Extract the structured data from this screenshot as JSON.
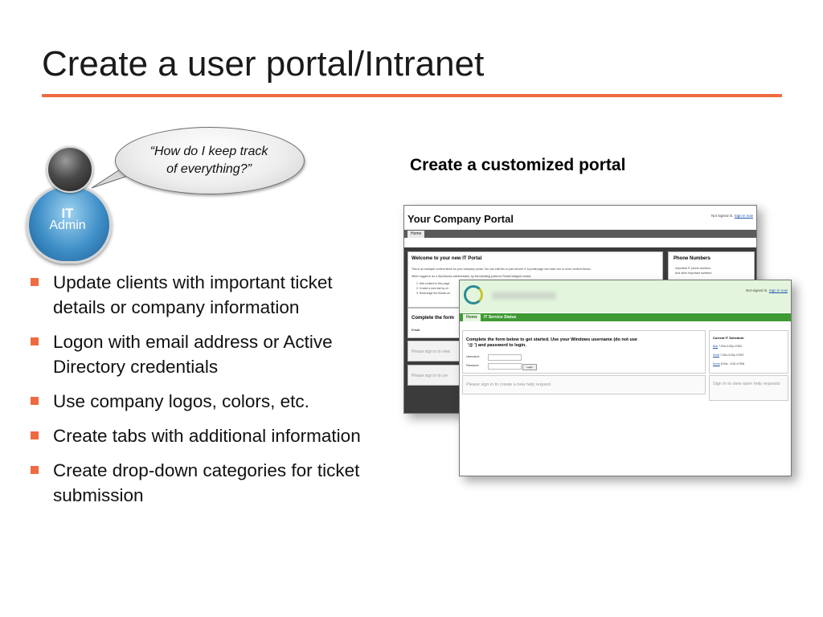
{
  "slide": {
    "title": "Create a user portal/Intranet",
    "accent_color": "#ef6b3f"
  },
  "admin_figure": {
    "icon": "person-admin-icon",
    "line1": "IT",
    "line2": "Admin"
  },
  "bubble": {
    "line1": "“How do I keep track",
    "line2": "of everything?”"
  },
  "portal_heading": "Create a customized portal",
  "bullets": [
    "Update clients with important ticket details or company information",
    "Logon with email address or Active Directory credentials",
    "Use company logos, colors, etc.",
    "Create tabs with additional information",
    "Create drop-down categories for ticket submission"
  ],
  "back_portal": {
    "title": "Your Company Portal",
    "signin_prefix": "Not signed in.",
    "signin_link": "Sign in now",
    "tab_home": "Home",
    "welcome_heading": "Welcome to your new IT Portal",
    "welcome_lines": [
      "This is an example content block for your company portal. You can edit this or just remove it. A portal page can have one or more content blocks.",
      "When logged in as a Spiceworks administrator, try the following (when in Portal Designer mode):",
      "1. Add content to this page",
      "2. Create a new tab by cli",
      "3. Rearrange the blocks on"
    ],
    "phone_heading": "Phone Numbers",
    "phone_lines": [
      "Important IT phone numbers",
      "And other important numbers"
    ],
    "form_heading": "Complete the form",
    "email_label": "Email:",
    "grey1": "Please sign in to view",
    "grey2": "Please sign in to cre"
  },
  "front_portal": {
    "signin_prefix": "Not signed in.",
    "signin_link": "Sign in now",
    "tab_home": "Home",
    "tab_status": "IT Service Status",
    "form_line1": "Complete the form below to get started. Use your Windows username (do not use",
    "form_line2": "'@                         ') and password to login.",
    "username_label": "Username:",
    "password_label": "Password:",
    "login_button": "Login",
    "create_text": "Please sign in to create a new help request",
    "schedule_heading": "Current IT Schedule:",
    "schedule": [
      {
        "name": "Bob",
        "time": "7:00a-4:30p x7642"
      },
      {
        "name": "Scott",
        "time": "7:00a-4:30p x7393"
      },
      {
        "name": "Kevin",
        "time": "8:00a - 5:30 x7398"
      }
    ],
    "view_text": "Sign in to view open help requests"
  }
}
